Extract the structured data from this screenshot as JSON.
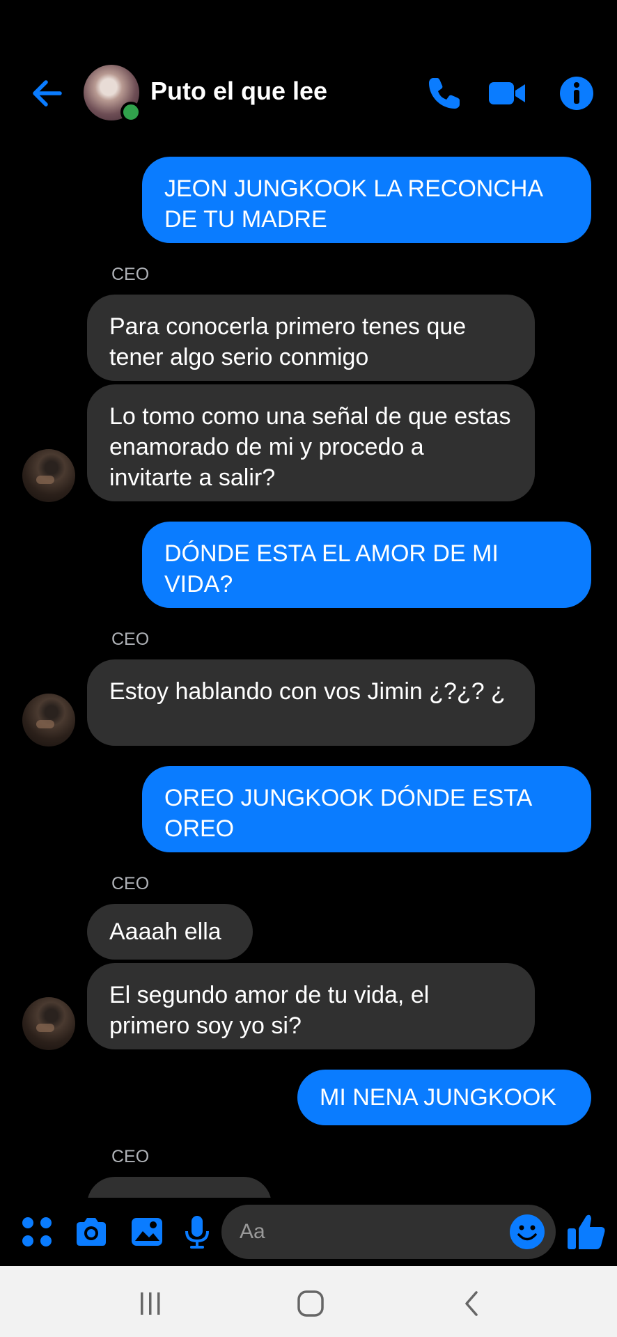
{
  "header": {
    "contact_name": "Puto el que lee",
    "status": "online",
    "icons": [
      "back-arrow-icon",
      "phone-icon",
      "video-camera-icon",
      "info-icon"
    ]
  },
  "messages": [
    {
      "dir": "out",
      "text": "JEON JUNGKOOK LA RECONCHA DE TU MADRE"
    },
    {
      "dir": "in",
      "sender": "CEO",
      "text": "Para conocerla primero tenes que tener algo serio conmigo"
    },
    {
      "dir": "in",
      "text": "Lo tomo como una señal de que estas enamorado de mi y procedo a invitarte a salir?"
    },
    {
      "dir": "out",
      "text": "DÓNDE ESTA EL AMOR DE MI VIDA?"
    },
    {
      "dir": "in",
      "sender": "CEO",
      "text": "Estoy hablando con vos Jimin ¿?¿? ¿"
    },
    {
      "dir": "out",
      "text": "OREO JUNGKOOK DÓNDE ESTA OREO"
    },
    {
      "dir": "in",
      "sender": "CEO",
      "text": "Aaaah ella"
    },
    {
      "dir": "in",
      "text": "El segundo amor de tu vida, el primero soy yo si?"
    },
    {
      "dir": "out",
      "text": "MI NENA JUNGKOOK"
    },
    {
      "dir": "in",
      "sender": "CEO",
      "text": ""
    }
  ],
  "composer": {
    "placeholder": "Aa",
    "icons": [
      "apps-icon",
      "camera-icon",
      "gallery-icon",
      "microphone-icon",
      "emoji-icon",
      "thumbs-up-icon"
    ]
  },
  "navbar": {
    "icons": [
      "recents-icon",
      "home-icon",
      "back-icon"
    ]
  },
  "colors": {
    "accent": "#0a7cff",
    "incoming_bubble": "#303030",
    "background": "#000000",
    "online": "#31a24c"
  }
}
